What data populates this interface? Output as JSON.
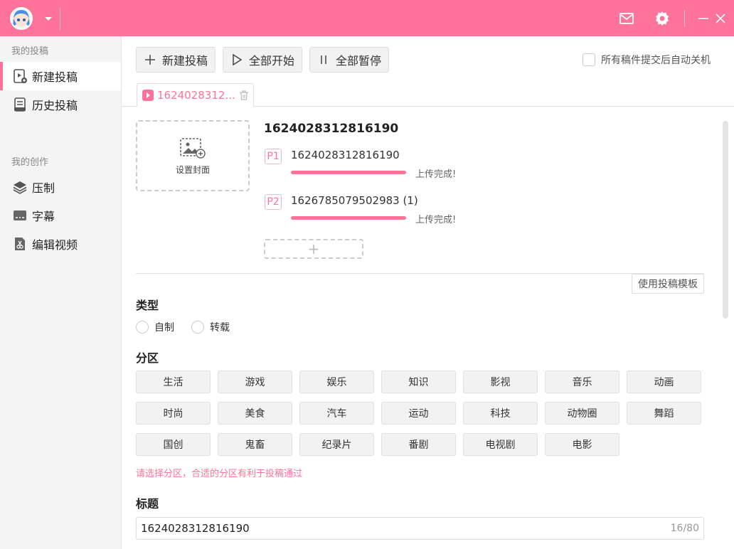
{
  "sidebar": {
    "group1": "我的投稿",
    "group2": "我的创作",
    "items": [
      {
        "label": "新建投稿"
      },
      {
        "label": "历史投稿"
      },
      {
        "label": "压制"
      },
      {
        "label": "字幕"
      },
      {
        "label": "编辑视频"
      }
    ]
  },
  "toolbar": {
    "new_label": "新建投稿",
    "start_all_label": "全部开始",
    "pause_all_label": "全部暂停",
    "auto_shutdown_label": "所有稿件提交后自动关机"
  },
  "tab": {
    "label": "1624028312..."
  },
  "cover": {
    "label": "设置封面"
  },
  "video": {
    "title": "1624028312816190",
    "parts": [
      {
        "badge": "P1",
        "name": "1624028312816190",
        "status": "上传完成!",
        "progress": 100
      },
      {
        "badge": "P2",
        "name": "1626785079502983 (1)",
        "status": "上传完成!",
        "progress": 100
      }
    ],
    "add_part": "+"
  },
  "template_button": "使用投稿模板",
  "type_section": {
    "heading": "类型",
    "options": [
      "自制",
      "转载"
    ]
  },
  "category_section": {
    "heading": "分区",
    "categories": [
      "生活",
      "游戏",
      "娱乐",
      "知识",
      "影视",
      "音乐",
      "动画",
      "时尚",
      "美食",
      "汽车",
      "运动",
      "科技",
      "动物圈",
      "舞蹈",
      "国创",
      "鬼畜",
      "纪录片",
      "番剧",
      "电视剧",
      "电影"
    ],
    "hint": "请选择分区，合适的分区有利于投稿通过"
  },
  "title_section": {
    "heading": "标题",
    "value": "1624028312816190",
    "count": "16/80"
  },
  "colors": {
    "accent": "#fd7399"
  }
}
